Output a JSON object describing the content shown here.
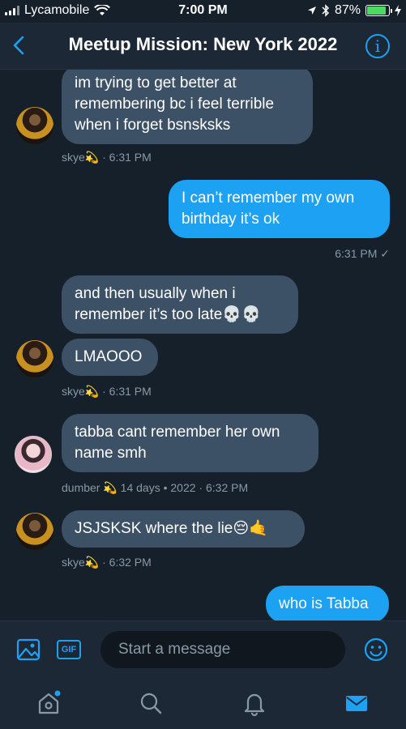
{
  "status_bar": {
    "carrier": "Lycamobile",
    "time": "7:00 PM",
    "battery": "87%",
    "battery_level": 0.87
  },
  "header": {
    "title": "Meetup Mission: New York 2022",
    "back_icon": "chevron-left-icon",
    "info_icon": "info-icon",
    "info_glyph": "i"
  },
  "messages": [
    {
      "id": "m1",
      "text": "im trying to get better at remembering bc i feel terrible when i forget bsnsksks"
    },
    {
      "id": "m1_meta",
      "text": "skye💫 · 6:31 PM"
    },
    {
      "id": "m2",
      "text": "I can’t remember my own birthday it’s ok"
    },
    {
      "id": "m2_meta",
      "text": "6:31 PM ✓"
    },
    {
      "id": "m3",
      "text": "and then usually when i remember it’s too late💀💀"
    },
    {
      "id": "m4",
      "text": "LMAOOO"
    },
    {
      "id": "m4_meta",
      "text": "skye💫 · 6:31 PM"
    },
    {
      "id": "m5",
      "text": "tabba cant remember her own name smh"
    },
    {
      "id": "m5_meta",
      "text": "dumber 💫 14 days • 2022 · 6:32 PM"
    },
    {
      "id": "m6",
      "text": "JSJSKSK where the lie😔🤙"
    },
    {
      "id": "m6_meta",
      "text": "skye💫 · 6:32 PM"
    },
    {
      "id": "m7",
      "text": "who is Tabba"
    }
  ],
  "composer": {
    "placeholder": "Start a message",
    "gif_label": "GIF",
    "image_icon": "image-icon",
    "emoji_icon": "emoji-icon"
  },
  "tabbar": {
    "items": [
      "home-icon",
      "search-icon",
      "notifications-icon",
      "messages-icon"
    ]
  },
  "colors": {
    "background": "#15202b",
    "incoming_bubble": "#3d5166",
    "outgoing_bubble": "#1da1f2",
    "accent": "#1da1f2",
    "meta_text": "#8899a6"
  }
}
